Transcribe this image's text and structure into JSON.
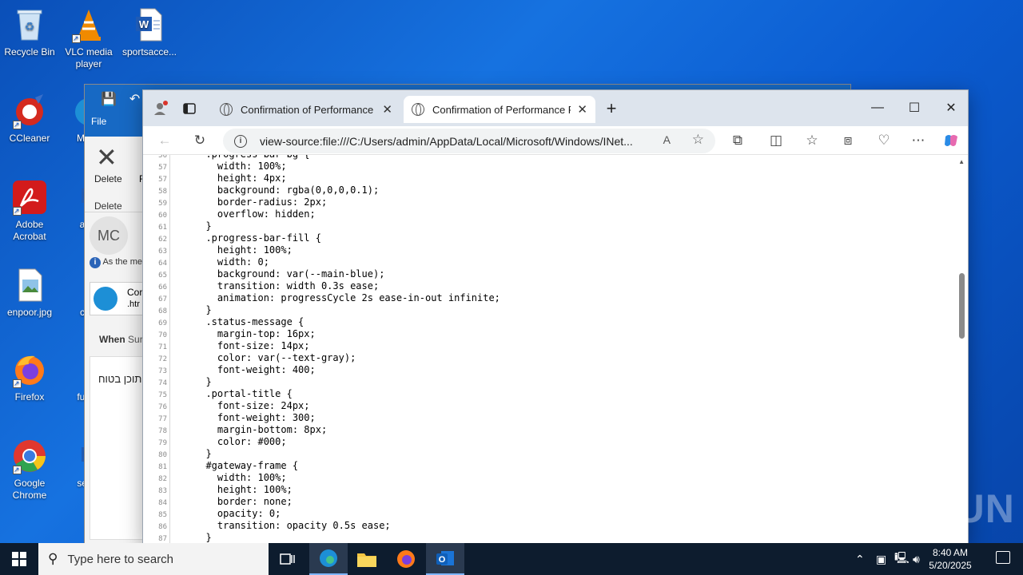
{
  "desktop": {
    "icons": [
      {
        "label": "Recycle Bin",
        "icon": "recycle-bin-icon"
      },
      {
        "label": "VLC media player",
        "icon": "vlc-icon"
      },
      {
        "label": "sportsacce...",
        "icon": "word-doc-icon"
      },
      {
        "label": "CCleaner",
        "icon": "ccleaner-icon"
      },
      {
        "label": "Adobe Acrobat",
        "icon": "acrobat-icon"
      },
      {
        "label": "enpoor.jpg",
        "icon": "image-file-icon"
      },
      {
        "label": "Firefox",
        "icon": "firefox-icon"
      },
      {
        "label": "Google Chrome",
        "icon": "chrome-icon"
      },
      {
        "label": "Mic E",
        "icon": "edge-icon"
      },
      {
        "label": "artsl",
        "icon": "word-doc-icon"
      },
      {
        "label": "colo",
        "icon": "word-doc-icon"
      },
      {
        "label": "funds",
        "icon": "word-doc-icon"
      },
      {
        "label": "sever",
        "icon": "word-doc-icon"
      }
    ]
  },
  "outlook": {
    "file_tab": "File",
    "delete_label": "Delete",
    "group_label": "Delete",
    "partial_f": "F",
    "avatar": "MC",
    "info_text": "As the me",
    "attachment_name": "Cor",
    "attachment_ext": ".htr",
    "when_label": "When",
    "when_value": "Sur",
    "body_text": "התוכן בטוח"
  },
  "browser": {
    "tabs": [
      {
        "title": "Confirmation of Performance",
        "active": false
      },
      {
        "title": "Confirmation of Performance Por",
        "active": true
      }
    ],
    "address": "view-source:file:///C:/Users/admin/AppData/Local/Microsoft/Windows/INet...",
    "source_lines": [
      {
        "n": "56",
        "code": "  .progress-bar-bg {"
      },
      {
        "n": "57",
        "code": "    width: 100%;"
      },
      {
        "n": "57",
        "code": "    height: 4px;"
      },
      {
        "n": "58",
        "code": "    background: rgba(0,0,0,0.1);"
      },
      {
        "n": "59",
        "code": "    border-radius: 2px;"
      },
      {
        "n": "60",
        "code": "    overflow: hidden;"
      },
      {
        "n": "61",
        "code": "  }"
      },
      {
        "n": "62",
        "code": "  .progress-bar-fill {"
      },
      {
        "n": "63",
        "code": "    height: 100%;"
      },
      {
        "n": "64",
        "code": "    width: 0;"
      },
      {
        "n": "65",
        "code": "    background: var(--main-blue);"
      },
      {
        "n": "66",
        "code": "    transition: width 0.3s ease;"
      },
      {
        "n": "67",
        "code": "    animation: progressCycle 2s ease-in-out infinite;"
      },
      {
        "n": "68",
        "code": "  }"
      },
      {
        "n": "69",
        "code": "  .status-message {"
      },
      {
        "n": "70",
        "code": "    margin-top: 16px;"
      },
      {
        "n": "71",
        "code": "    font-size: 14px;"
      },
      {
        "n": "72",
        "code": "    color: var(--text-gray);"
      },
      {
        "n": "73",
        "code": "    font-weight: 400;"
      },
      {
        "n": "74",
        "code": "  }"
      },
      {
        "n": "75",
        "code": "  .portal-title {"
      },
      {
        "n": "76",
        "code": "    font-size: 24px;"
      },
      {
        "n": "77",
        "code": "    font-weight: 300;"
      },
      {
        "n": "78",
        "code": "    margin-bottom: 8px;"
      },
      {
        "n": "79",
        "code": "    color: #000;"
      },
      {
        "n": "80",
        "code": "  }"
      },
      {
        "n": "81",
        "code": "  #gateway-frame {"
      },
      {
        "n": "82",
        "code": "    width: 100%;"
      },
      {
        "n": "83",
        "code": "    height: 100%;"
      },
      {
        "n": "84",
        "code": "    border: none;"
      },
      {
        "n": "85",
        "code": "    opacity: 0;"
      },
      {
        "n": "86",
        "code": "    transition: opacity 0.5s ease;"
      },
      {
        "n": "87",
        "code": "  }"
      }
    ]
  },
  "watermark": "ANY RUN",
  "taskbar": {
    "search_placeholder": "Type here to search",
    "time": "8:40 AM",
    "date": "5/20/2025"
  }
}
